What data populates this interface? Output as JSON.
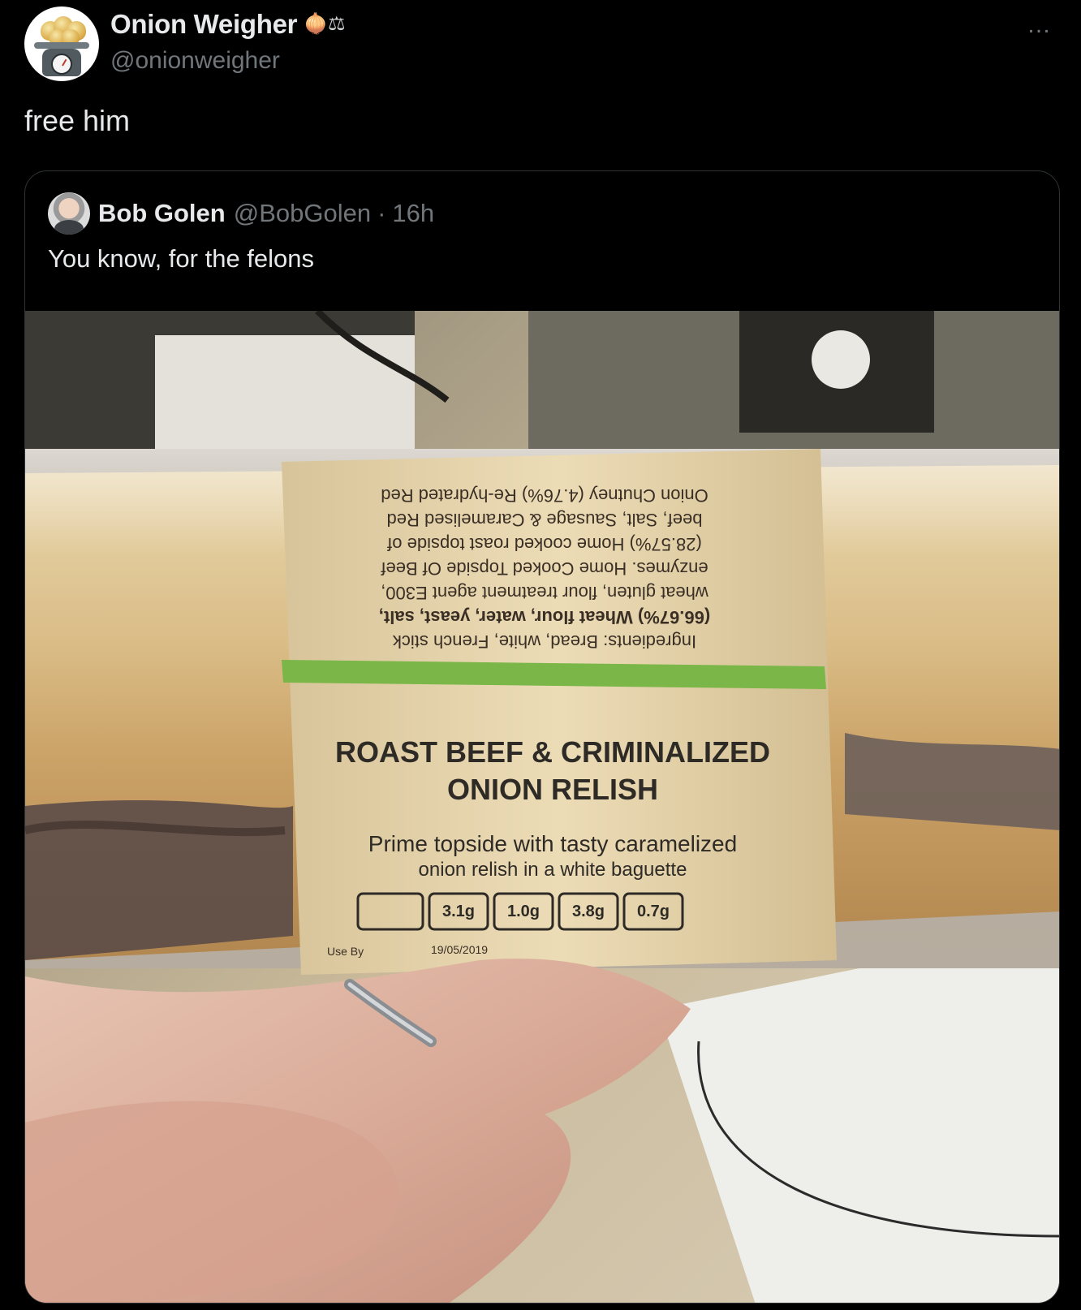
{
  "author": {
    "display_name": "Onion Weigher",
    "name_emoji": "🧅⚖",
    "handle": "@onionweigher",
    "avatar": "onion-on-scale-avatar"
  },
  "post": {
    "text": "free him",
    "more_icon": "…"
  },
  "quoted": {
    "display_name": "Bob Golen",
    "handle": "@BobGolen",
    "separator": "·",
    "time": "16h",
    "text": "You know, for the felons",
    "photo": {
      "label_title_line1": "ROAST BEEF & CRIMINALIZED",
      "label_title_line2": "ONION RELISH",
      "label_subtitle_line1": "Prime topside with tasty caramelized",
      "label_subtitle_line2": "onion relish in a white baguette",
      "ingredients_lines": [
        "Ingredients: Bread, white, French stick",
        "(66.67%) Wheat flour, water, yeast, salt,",
        "wheat gluten, flour treatment agent E300,",
        "enzymes. Home Cooked Topside Of Beef",
        "(28.57%) Home cooked roast topside of",
        "beef, Salt, Sausage & Caramelised Red",
        "Onion Chutney (4.76%) Re-hydrated Red"
      ],
      "nutrition_values": [
        "3.1g",
        "1.0g",
        "3.8g",
        "0.7g"
      ],
      "use_by_label": "Use By",
      "use_by_date": "19/05/2019"
    }
  },
  "colors": {
    "background": "#000000",
    "text_primary": "#e7e9ea",
    "text_secondary": "#71767b",
    "card_border": "#2f3336",
    "label_paper": "#e8d7b0",
    "label_green_stripe": "#7ab648"
  }
}
